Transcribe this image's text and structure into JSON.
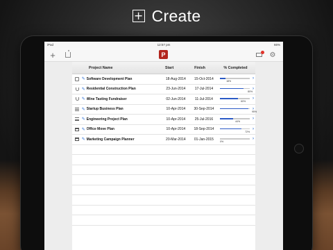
{
  "headline": {
    "label": "Create"
  },
  "status_bar": {
    "time": "12:57 pm",
    "battery": "66%"
  },
  "table": {
    "headers": {
      "name": "Project Name",
      "start": "Start",
      "finish": "Finish",
      "pct": "% Completed"
    },
    "rows": [
      {
        "icon": "doc",
        "name": "Software Development Plan",
        "start": "18-Aug-2014",
        "finish": "15-Oct-2014",
        "pct": 18,
        "pct_label": "18%"
      },
      {
        "icon": "cup",
        "name": "Residential Construction Plan",
        "start": "23-Jun-2014",
        "finish": "17-Jul-2014",
        "pct": 80,
        "pct_label": "80%"
      },
      {
        "icon": "cup",
        "name": "Wine Tasting Fundraiser",
        "start": "02-Jun-2014",
        "finish": "11-Jul-2014",
        "pct": 60,
        "pct_label": "60%"
      },
      {
        "icon": "lines",
        "name": "Startup Business Plan",
        "start": "10-Apr-2014",
        "finish": "30-Sep-2014",
        "pct": 95,
        "pct_label": "95%"
      },
      {
        "icon": "lines",
        "name": "Engineering Project Plan",
        "start": "10-Apr-2014",
        "finish": "25-Jul-2016",
        "pct": 44,
        "pct_label": "44%"
      },
      {
        "icon": "cal",
        "name": "Office Move Plan",
        "start": "10-Apr-2014",
        "finish": "18-Sep-2014",
        "pct": 72,
        "pct_label": "72%"
      },
      {
        "icon": "cal",
        "name": "Marketing Campaign Planner",
        "start": "20-Mar-2014",
        "finish": "01-Jan-2015",
        "pct": 0,
        "pct_label": "0%"
      }
    ]
  },
  "icons": {
    "add": "plus-icon",
    "import": "import-icon",
    "logo": "P",
    "mail": "mail-icon",
    "settings": "gear-icon",
    "edit": "pencil-icon",
    "chevron": "chevron-right-icon"
  },
  "colors": {
    "progress": "#2a59c6",
    "logo": "#b3261e",
    "link": "#2b6fd6"
  }
}
